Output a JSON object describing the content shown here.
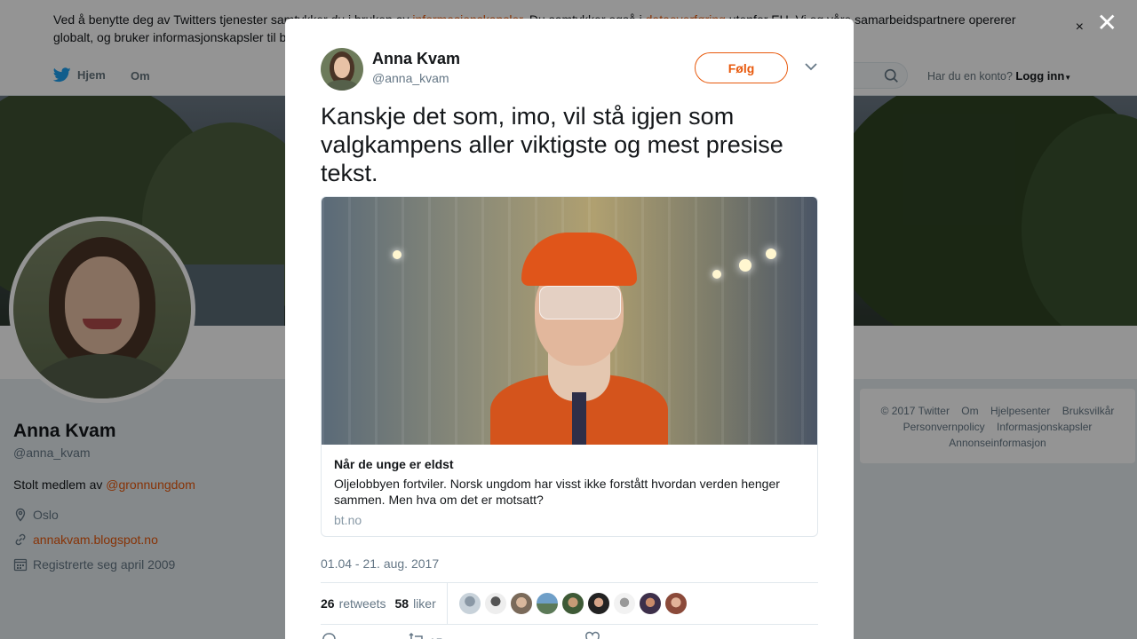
{
  "cookie": {
    "line1_a": "Ved å benytte deg av Twitters tjenester samtykker du i bruken av ",
    "line1_link1": "informasjonskapsler",
    "line1_b": ". Du samtykker også i ",
    "line1_link2": "dataoverføring",
    "line1_c": " utenfor EU. Vi og våre samarbeidspartnere opererer",
    "line2": "globalt, og bruker informasjonskapsler til b",
    "close": "×"
  },
  "nav": {
    "home": "Hjem",
    "about": "Om",
    "login_prompt": "Har du en konto?",
    "login": "Logg inn"
  },
  "profile": {
    "name": "Anna Kvam",
    "handle": "@anna_kvam",
    "bio_prefix": "Stolt medlem av ",
    "bio_link": "@gronnungdom",
    "location": "Oslo",
    "website": "annakvam.blogspot.no",
    "joined": "Registrerte seg april 2009"
  },
  "footer": {
    "copyright": "© 2017 Twitter",
    "about": "Om",
    "help": "Hjelpesenter",
    "terms": "Bruksvilkår",
    "privacy": "Personvernpolicy",
    "cookies": "Informasjonskapsler",
    "ads": "Annonseinformasjon"
  },
  "modal": {
    "close": "✕",
    "author_name": "Anna Kvam",
    "author_handle": "@anna_kvam",
    "follow": "Følg",
    "text": "Kanskje det som, imo, vil stå igjen som valgkampens aller viktigste og mest presise tekst.",
    "card": {
      "title": "Når de unge er eldst",
      "description": "Oljelobbyen fortviler. Norsk ungdom har visst ikke forstått hvordan verden henger sammen. Men hva om det er motsatt?",
      "domain": "bt.no"
    },
    "date": "01.04 - 21. aug. 2017",
    "retweets_count": "26",
    "retweets_label": "retweets",
    "likes_count": "58",
    "likes_label": "liker",
    "action_reply_count": "",
    "action_retweet_count": "15",
    "action_like_count": ""
  },
  "colors": {
    "accent": "#e8590c",
    "twitter_blue": "#1da1f2"
  }
}
